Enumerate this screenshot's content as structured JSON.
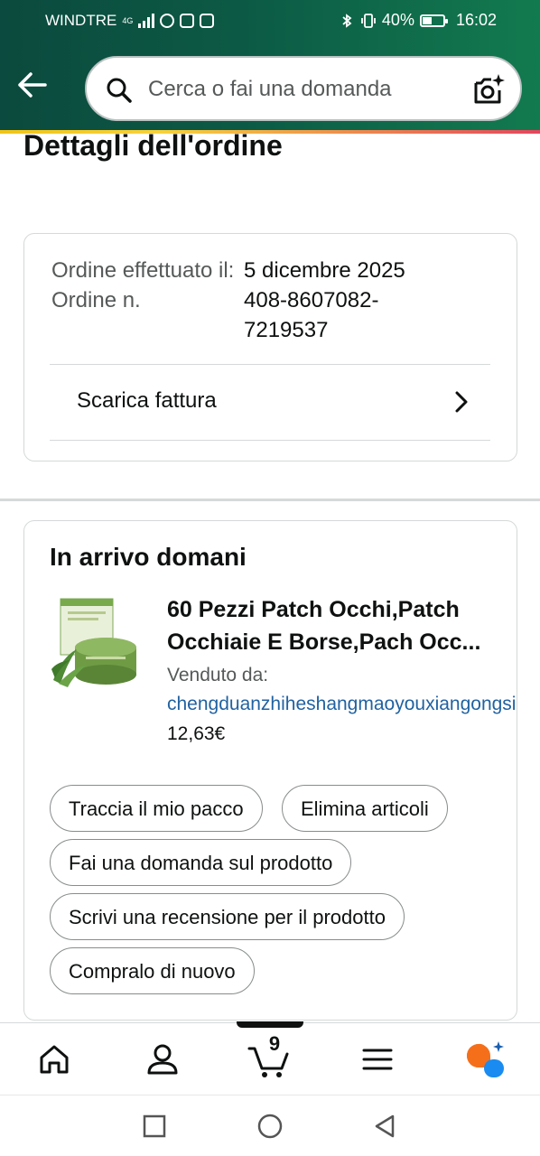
{
  "status": {
    "carrier": "WINDTRE",
    "network": "4G",
    "battery_percent": "40%",
    "time": "16:02"
  },
  "header": {
    "search_placeholder": "Cerca o fai una domanda"
  },
  "page": {
    "title": "Dettagli dell'ordine"
  },
  "order": {
    "labels": [
      "Ordine effettuato il:",
      "Ordine n."
    ],
    "placed_date": "5 dicembre 2025",
    "number": "408-8607082-7219537",
    "invoice_label": "Scarica fattura"
  },
  "shipment": {
    "heading": "In arrivo domani",
    "product_title": "60 Pezzi Patch Occhi,Patch Occhiaie E Borse,Pach Occ...",
    "seller_label": "Venduto da:",
    "seller_name": "chengduanzhiheshangmaoyouxiangongsi",
    "price": "12,63€",
    "actions": [
      "Traccia il mio pacco",
      "Elimina articoli",
      "Fai una domanda sul prodotto",
      "Scrivi una recensione per il prodotto",
      "Compralo di nuovo"
    ]
  },
  "bottom_nav": {
    "cart_count": "9"
  },
  "colors": {
    "header_start": "#0b4a3e",
    "header_end": "#127a4f",
    "link": "#2162a1",
    "assistant_orange": "#f56f1b",
    "assistant_blue": "#1a8bf0"
  }
}
